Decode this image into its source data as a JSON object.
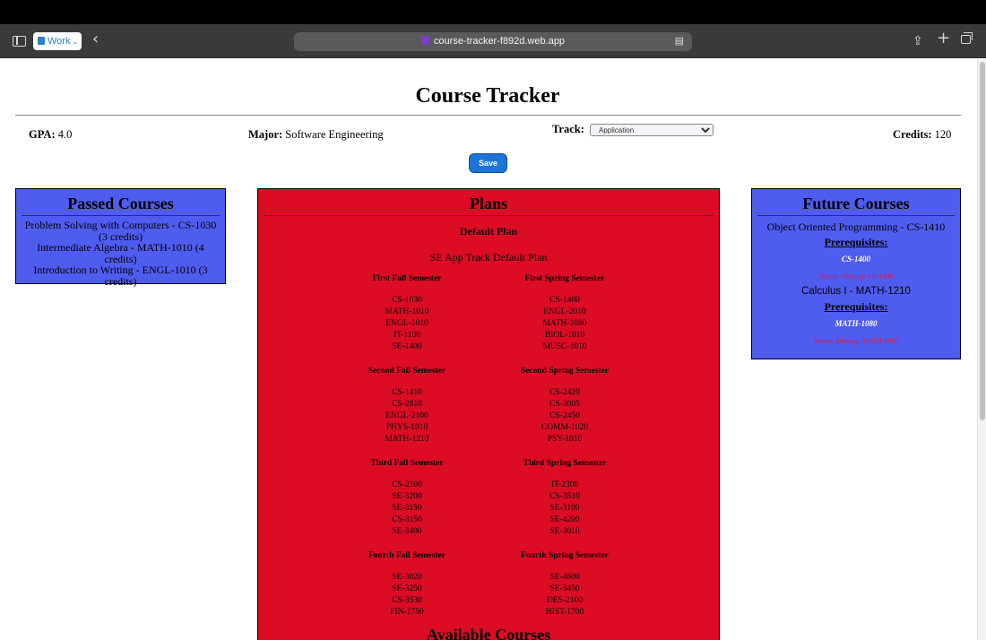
{
  "browser": {
    "tab_group": "Work",
    "url": "course-tracker-f892d.web.app"
  },
  "header": {
    "title": "Course Tracker",
    "gpa_label": "GPA:",
    "gpa_value": "4.0",
    "major_label": "Major:",
    "major_value": "Software Engineering",
    "track_label": "Track:",
    "track_value": "Application",
    "credits_label": "Credits:",
    "credits_value": "120",
    "save_label": "Save"
  },
  "passed": {
    "title": "Passed Courses",
    "items": [
      "Problem Solving with Computers - CS-1030 (3 credits)",
      "Intermediate Algebra - MATH-1010 (4 credits)",
      "Introduction to Writing - ENGL-1010 (3 credits)"
    ]
  },
  "plans": {
    "title": "Plans",
    "plan_name": "Default Plan",
    "plan_description": "SE App Track Default Plan",
    "semesters": [
      {
        "name": "First Fall Semester",
        "courses": [
          "CS-1030",
          "MATH-1010",
          "ENGL-1010",
          "IT-1100",
          "SE-1400"
        ]
      },
      {
        "name": "First Spring Semester",
        "courses": [
          "CS-1400",
          "ENGL-2010",
          "MATH-1080",
          "BIOL-1010",
          "MUSC-1010"
        ]
      },
      {
        "name": "Second Fall Semester",
        "courses": [
          "CS-1410",
          "CS-2810",
          "ENGL-2100",
          "PHYS-1010",
          "MATH-1210"
        ]
      },
      {
        "name": "Second Spring Semester",
        "courses": [
          "CS-2420",
          "CS-3005",
          "CS-2450",
          "COMM-1020",
          "PSY-1010"
        ]
      },
      {
        "name": "Third Fall Semester",
        "courses": [
          "CS-2100",
          "SE-3200",
          "SE-3150",
          "CS-3150",
          "SE-3400"
        ]
      },
      {
        "name": "Third Spring Semester",
        "courses": [
          "IT-2300",
          "CS-3510",
          "SE-3100",
          "SE-4200",
          "SE-3010"
        ]
      },
      {
        "name": "Fourth Fall Semester",
        "courses": [
          "SE-3020",
          "SE-3250",
          "CS-3530",
          "FIN-1750"
        ]
      },
      {
        "name": "Fourth Spring Semester",
        "courses": [
          "SE-4600",
          "SE-3450",
          "DES-2100",
          "HIST-1700"
        ]
      }
    ],
    "available_title": "Available Courses"
  },
  "future": {
    "title": "Future Courses",
    "prereq_heading": "Prerequisites:",
    "courses": [
      {
        "name": "Object Oriented Programming - CS-1410",
        "prereq": "CS-1400",
        "status": "Status: Missing: CS-1400"
      },
      {
        "name": "Calculus I - MATH-1210",
        "prereq": "MATH-1080",
        "status": "Status: Missing: MATH-1080"
      }
    ]
  },
  "colors": {
    "passed_bg": "#4f5cf0",
    "plans_bg": "#dc0c25",
    "future_bg": "#4f5cf0",
    "save_button": "#1b74d8",
    "status_text": "#e4173a"
  }
}
